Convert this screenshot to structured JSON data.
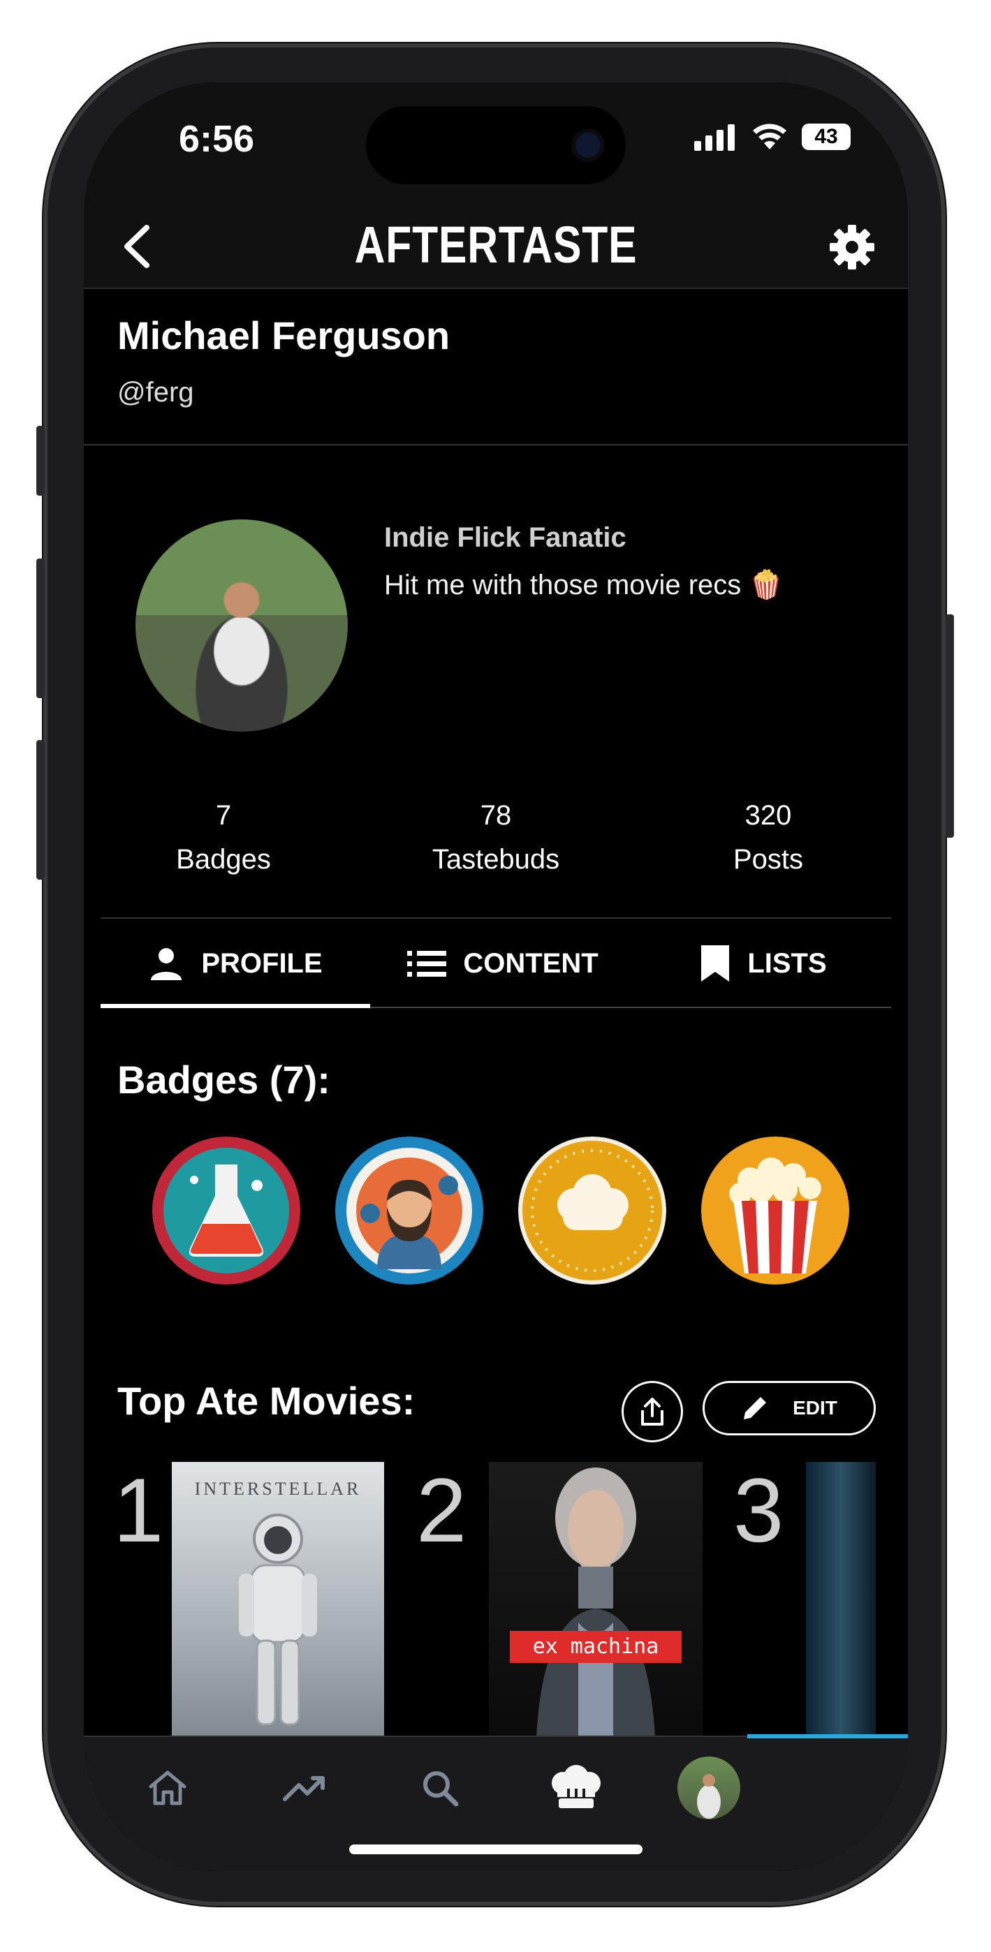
{
  "status_bar": {
    "time": "6:56",
    "battery": "43"
  },
  "header": {
    "app_title": "AFTERTASTE"
  },
  "user": {
    "name": "Michael Ferguson",
    "handle": "@ferg"
  },
  "bio": {
    "title": "Indie Flick Fanatic",
    "text": "Hit me with those movie recs 🍿"
  },
  "stats": [
    {
      "value": "7",
      "label": "Badges"
    },
    {
      "value": "78",
      "label": "Tastebuds"
    },
    {
      "value": "320",
      "label": "Posts"
    }
  ],
  "tabs": [
    {
      "label": "PROFILE",
      "icon": "person-icon",
      "active": true
    },
    {
      "label": "CONTENT",
      "icon": "list-icon",
      "active": false
    },
    {
      "label": "LISTS",
      "icon": "bookmark-icon",
      "active": false
    }
  ],
  "badges": {
    "title": "Badges (7):",
    "items": [
      {
        "icon": "flask-badge-icon"
      },
      {
        "icon": "scientist-badge-icon"
      },
      {
        "icon": "cloud-badge-icon"
      },
      {
        "icon": "popcorn-badge-icon"
      }
    ]
  },
  "top_movies": {
    "title": "Top Ate Movies:",
    "edit_label": "EDIT",
    "items": [
      {
        "rank": "1",
        "poster_text": "INTERSTELLAR"
      },
      {
        "rank": "2",
        "poster_text": "ex machina"
      },
      {
        "rank": "3",
        "poster_text": ""
      }
    ]
  },
  "nav": [
    {
      "icon": "home-icon"
    },
    {
      "icon": "trending-icon"
    },
    {
      "icon": "search-icon"
    },
    {
      "icon": "chef-hat-icon"
    },
    {
      "icon": "profile-avatar-icon",
      "active": true
    }
  ]
}
